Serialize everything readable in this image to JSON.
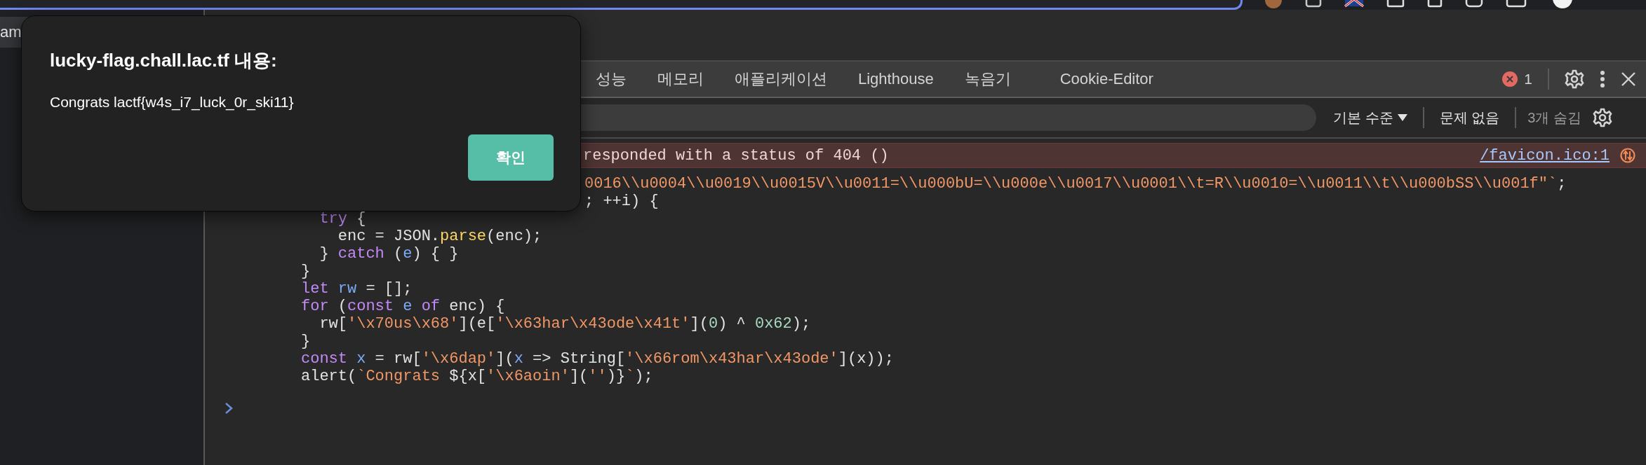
{
  "browser": {
    "left_tab_label": "am"
  },
  "devtools": {
    "tabs": [
      {
        "label": "성능",
        "selected": false
      },
      {
        "label": "메모리",
        "selected": false
      },
      {
        "label": "애플리케이션",
        "selected": false
      },
      {
        "label": "Lighthouse",
        "selected": false
      },
      {
        "label": "녹음기",
        "selected": false
      },
      {
        "label": "Cookie-Editor",
        "selected": false
      }
    ],
    "error_count": "1",
    "filter": {
      "level": "기본 수준",
      "issues": "문제 없음",
      "hidden": "3개 숨김"
    }
  },
  "console": {
    "error": {
      "message": "responded with a status of 404 ()",
      "source": "/favicon.ico:1"
    },
    "code_lines": [
      {
        "covered": true,
        "tokens": [
          {
            "kind": "string",
            "text": "0016\\\\u0004\\\\u0019\\\\u0015V\\\\u0011=\\\\u000bU=\\\\u000e\\\\u0017\\\\u0001\\\\t=R\\\\u0010=\\\\u0011\\\\t\\\\u000bSS\\\\u001f\"`"
          },
          {
            "kind": "plain",
            "text": ";"
          }
        ]
      },
      {
        "covered": true,
        "tokens": [
          {
            "kind": "plain",
            "text": "; ++i) {"
          }
        ]
      },
      {
        "covered": false,
        "tokens": [
          {
            "kind": "keyword",
            "text": "  try"
          },
          {
            "kind": "plain",
            "text": " {"
          }
        ]
      },
      {
        "covered": false,
        "tokens": [
          {
            "kind": "plain",
            "text": "    enc = JSON."
          },
          {
            "kind": "method",
            "text": "parse"
          },
          {
            "kind": "plain",
            "text": "(enc);"
          }
        ]
      },
      {
        "covered": false,
        "tokens": [
          {
            "kind": "plain",
            "text": "  } "
          },
          {
            "kind": "keyword",
            "text": "catch"
          },
          {
            "kind": "plain",
            "text": " ("
          },
          {
            "kind": "variable",
            "text": "e"
          },
          {
            "kind": "plain",
            "text": ") { }"
          }
        ]
      },
      {
        "covered": false,
        "tokens": [
          {
            "kind": "plain",
            "text": "}"
          }
        ]
      },
      {
        "covered": false,
        "tokens": [
          {
            "kind": "keyword",
            "text": "let "
          },
          {
            "kind": "variable",
            "text": "rw"
          },
          {
            "kind": "plain",
            "text": " = [];"
          }
        ]
      },
      {
        "covered": false,
        "tokens": [
          {
            "kind": "keyword",
            "text": "for"
          },
          {
            "kind": "plain",
            "text": " ("
          },
          {
            "kind": "keyword",
            "text": "const "
          },
          {
            "kind": "variable",
            "text": "e"
          },
          {
            "kind": "keyword",
            "text": " of"
          },
          {
            "kind": "plain",
            "text": " enc) {"
          }
        ]
      },
      {
        "covered": false,
        "tokens": [
          {
            "kind": "plain",
            "text": "  rw["
          },
          {
            "kind": "string",
            "text": "'\\x70us\\x68'"
          },
          {
            "kind": "plain",
            "text": "](e["
          },
          {
            "kind": "string",
            "text": "'\\x63har\\x43ode\\x41t'"
          },
          {
            "kind": "plain",
            "text": "]("
          },
          {
            "kind": "number",
            "text": "0"
          },
          {
            "kind": "plain",
            "text": ") ^ "
          },
          {
            "kind": "number",
            "text": "0x62"
          },
          {
            "kind": "plain",
            "text": ");"
          }
        ]
      },
      {
        "covered": false,
        "tokens": [
          {
            "kind": "plain",
            "text": "}"
          }
        ]
      },
      {
        "covered": false,
        "tokens": [
          {
            "kind": "keyword",
            "text": "const "
          },
          {
            "kind": "variable",
            "text": "x"
          },
          {
            "kind": "plain",
            "text": " = rw["
          },
          {
            "kind": "string",
            "text": "'\\x6dap'"
          },
          {
            "kind": "plain",
            "text": "]("
          },
          {
            "kind": "variable",
            "text": "x"
          },
          {
            "kind": "plain",
            "text": " => String["
          },
          {
            "kind": "string",
            "text": "'\\x66rom\\x43har\\x43ode'"
          },
          {
            "kind": "plain",
            "text": "](x));"
          }
        ]
      },
      {
        "covered": false,
        "tokens": [
          {
            "kind": "plain",
            "text": "alert("
          },
          {
            "kind": "string",
            "text": "`Congrats "
          },
          {
            "kind": "plain",
            "text": "${x["
          },
          {
            "kind": "string",
            "text": "'\\x6aoin'"
          },
          {
            "kind": "plain",
            "text": "]("
          },
          {
            "kind": "string",
            "text": "''"
          },
          {
            "kind": "plain",
            "text": ")}"
          },
          {
            "kind": "string",
            "text": "`"
          },
          {
            "kind": "plain",
            "text": ");"
          }
        ]
      }
    ]
  },
  "dialog": {
    "title": "lucky-flag.chall.lac.tf 내용:",
    "message": "Congrats lactf{w4s_i7_luck_0r_ski11}",
    "button": "확인"
  }
}
